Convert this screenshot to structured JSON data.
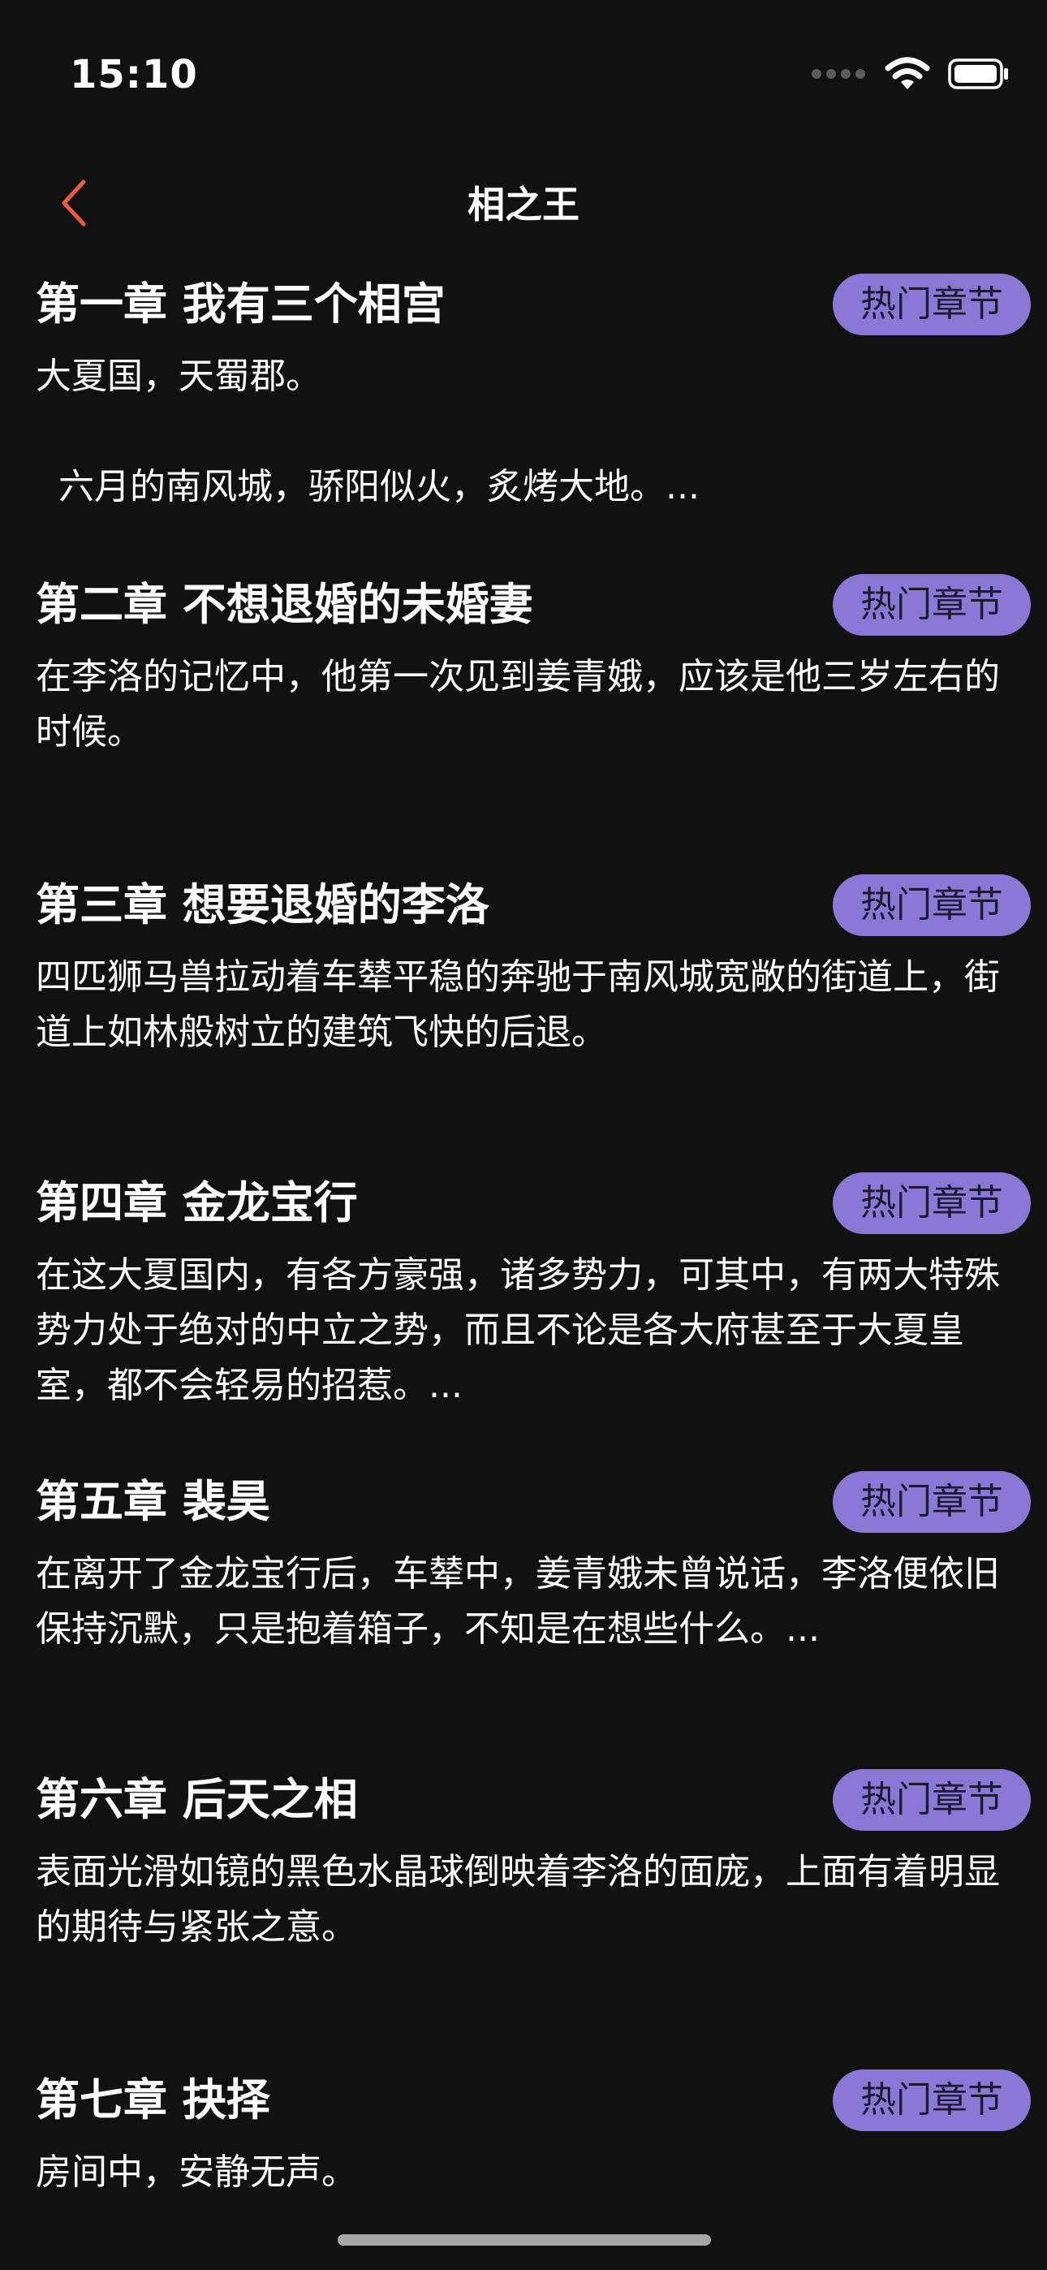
{
  "status_bar": {
    "time": "15:10"
  },
  "nav": {
    "title": "相之王"
  },
  "badge_color": "#8a77d6",
  "chapters": [
    {
      "title": "第一章 我有三个相宫",
      "badge": "热门章节",
      "excerpt": "大夏国，天蜀郡。\n\n  六月的南风城，骄阳似火，炙烤大地。..."
    },
    {
      "title": "第二章 不想退婚的未婚妻",
      "badge": "热门章节",
      "excerpt": "在李洛的记忆中，他第一次见到姜青娥，应该是他三岁左右的时候。"
    },
    {
      "title": "第三章 想要退婚的李洛",
      "badge": "热门章节",
      "excerpt": "四匹狮马兽拉动着车辇平稳的奔驰于南风城宽敞的街道上，街道上如林般树立的建筑飞快的后退。"
    },
    {
      "title": "第四章 金龙宝行",
      "badge": "热门章节",
      "excerpt": "在这大夏国内，有各方豪强，诸多势力，可其中，有两大特殊势力处于绝对的中立之势，而且不论是各大府甚至于大夏皇室，都不会轻易的招惹。..."
    },
    {
      "title": "第五章 裴昊",
      "badge": "热门章节",
      "excerpt": "在离开了金龙宝行后，车辇中，姜青娥未曾说话，李洛便依旧保持沉默，只是抱着箱子，不知是在想些什么。..."
    },
    {
      "title": "第六章 后天之相",
      "badge": "热门章节",
      "excerpt": "表面光滑如镜的黑色水晶球倒映着李洛的面庞，上面有着明显的期待与紧张之意。"
    },
    {
      "title": "第七章 抉择",
      "badge": "热门章节",
      "excerpt": "房间中，安静无声。"
    }
  ]
}
